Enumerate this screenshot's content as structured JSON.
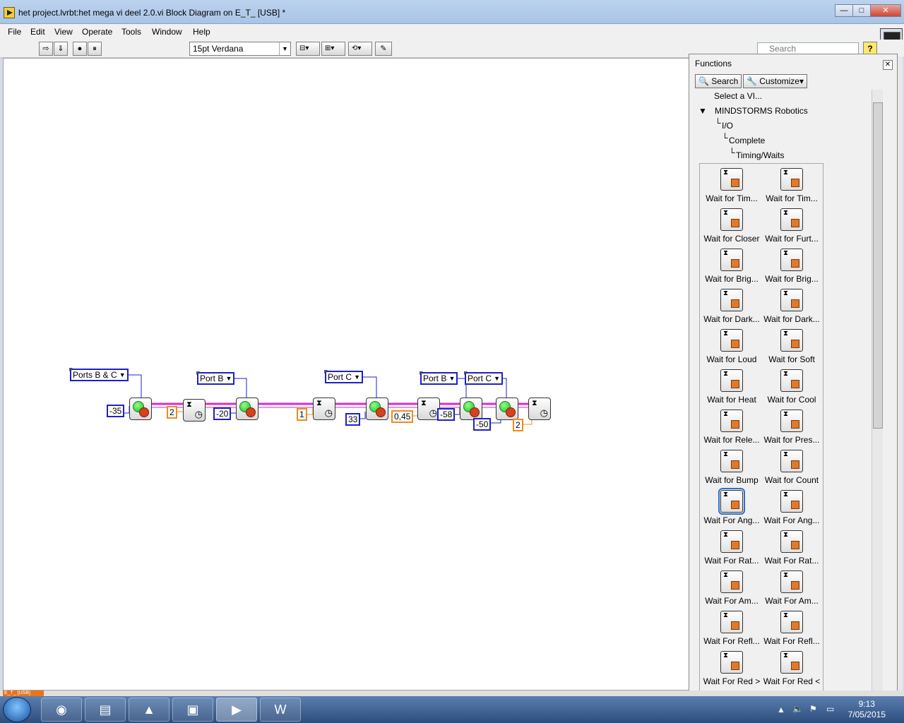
{
  "window": {
    "title": "het project.lvrbt:het mega vi deel 2.0.vi Block Diagram on E_T_ [USB] *",
    "minimize": "—",
    "maximize": "□",
    "close": "✕"
  },
  "menu": [
    "File",
    "Edit",
    "View",
    "Operate",
    "Tools",
    "Window",
    "Help"
  ],
  "toolbar": {
    "font": "15pt Verdana",
    "search_placeholder": "Search",
    "help": "?"
  },
  "diagram": {
    "rings": [
      "Ports B & C",
      "Port B",
      "Port C",
      "Port B",
      "Port C"
    ],
    "constants": [
      "-35",
      "2",
      "-20",
      "1",
      "33",
      "0,45",
      "-58",
      "-50",
      "2"
    ]
  },
  "palette": {
    "title": "Functions",
    "search_label": "Search",
    "customize_label": "Customize",
    "tree": [
      "Select a VI...",
      "MINDSTORMS Robotics",
      "I/O",
      "Complete",
      "Timing/Waits"
    ],
    "items": [
      "Wait for Tim...",
      "Wait for Tim...",
      "Wait for Closer",
      "Wait for Furt...",
      "Wait for Brig...",
      "Wait for Brig...",
      "Wait for Dark...",
      "Wait for Dark...",
      "Wait for Loud",
      "Wait for Soft",
      "Wait for Heat",
      "Wait for Cool",
      "Wait for Rele...",
      "Wait for Pres...",
      "Wait for Bump",
      "Wait for Count",
      "Wait For Ang...",
      "Wait For Ang...",
      "Wait For Rat...",
      "Wait For Rat...",
      "Wait For Am...",
      "Wait For Am...",
      "Wait For Refl...",
      "Wait For Refl...",
      "Wait For Red >",
      "Wait For Red <"
    ]
  },
  "status": {
    "context": "E_T_ [USB]"
  },
  "taskbar": {
    "time": "9:13",
    "date": "7/05/2015"
  },
  "colors": {
    "wire_pink": "#d52fd5",
    "numeric_blue": "#1f20c8",
    "numeric_orange": "#f08b1e"
  }
}
